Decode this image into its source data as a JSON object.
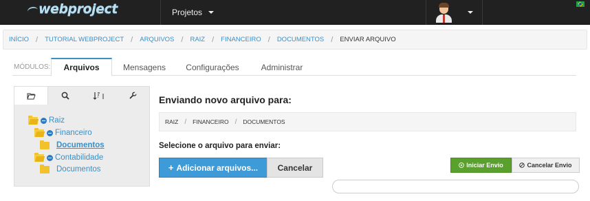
{
  "app": {
    "logo_text": "webproject"
  },
  "navbar": {
    "projects_label": "Projetos"
  },
  "breadcrumb": [
    {
      "label": "INÍCIO"
    },
    {
      "label": "TUTORIAL WEBPROJECT"
    },
    {
      "label": "ARQUIVOS"
    },
    {
      "label": "RAIZ"
    },
    {
      "label": "FINANCEIRO"
    },
    {
      "label": "DOCUMENTOS"
    },
    {
      "label": "ENVIAR ARQUIVO"
    }
  ],
  "modules": {
    "label": "MÓDULOS:",
    "tabs": [
      {
        "label": "Arquivos",
        "active": true
      },
      {
        "label": "Mensagens",
        "active": false
      },
      {
        "label": "Configurações",
        "active": false
      },
      {
        "label": "Administrar",
        "active": false
      }
    ]
  },
  "tree": {
    "tool_icons": [
      "folder-open-icon",
      "search-icon",
      "sort-icon",
      "wrench-icon"
    ],
    "nodes": [
      {
        "label": "Raiz"
      },
      {
        "label": "Financeiro"
      },
      {
        "label": "Documentos",
        "selected": true
      },
      {
        "label": "Contabilidade"
      },
      {
        "label": "Documentos"
      }
    ]
  },
  "main": {
    "heading": "Enviando novo arquivo para:",
    "path": [
      "RAIZ",
      "FINANCEIRO",
      "DOCUMENTOS"
    ],
    "select_label": "Selecione o arquivo para enviar:",
    "add_files_label": "Adicionar arquivos...",
    "cancel_label": "Cancelar",
    "start_upload_label": "Iniciar Envio",
    "cancel_upload_label": "Cancelar Envio",
    "progress": 0
  },
  "colors": {
    "accent": "#3a8fc7",
    "primary_button": "#3f9ad8",
    "success_button": "#5aa02c",
    "navbar": "#212121"
  }
}
